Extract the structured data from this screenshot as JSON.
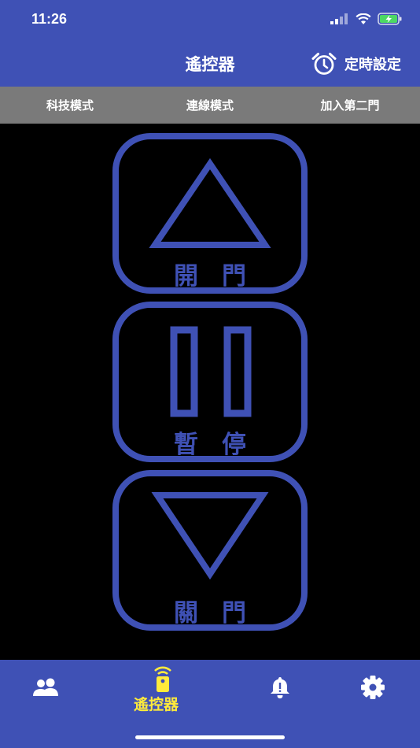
{
  "status_bar": {
    "time": "11:26"
  },
  "header": {
    "title": "遙控器",
    "timer_label": "定時設定"
  },
  "modes": [
    "科技模式",
    "連線模式",
    "加入第二門"
  ],
  "controls": {
    "open_label": "開門",
    "pause_label": "暫停",
    "close_label": "關門"
  },
  "nav": {
    "remote_label": "遙控器",
    "active_color": "#ffeb3b"
  },
  "colors": {
    "brand": "#3f51b5",
    "mode_bar": "#7a7a7a",
    "background": "#000000"
  }
}
